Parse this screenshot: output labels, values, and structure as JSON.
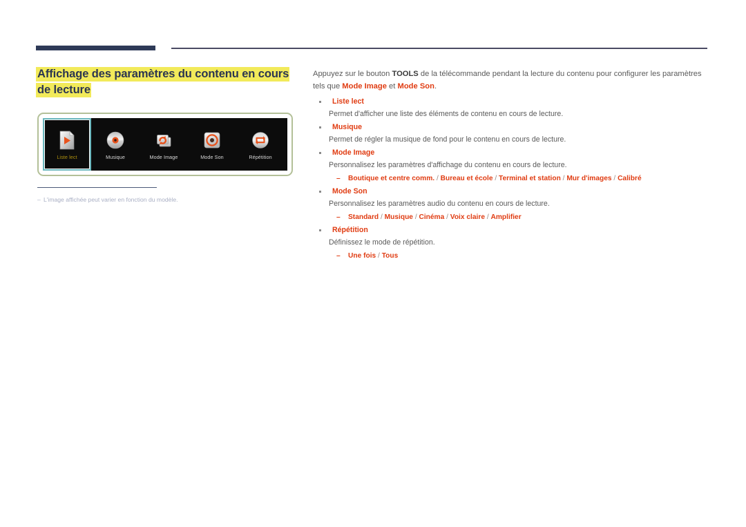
{
  "header": {
    "rule_thick": "navy-bar",
    "rule_thin": "thin-divider",
    "accent_navy": "#2e3a57",
    "accent_red": "#e03c12",
    "highlight_yellow": "#f2ea5a",
    "frame_green": "#b3c098"
  },
  "title": {
    "text": "Affichage des paramètres du contenu en cours de lecture"
  },
  "figure": {
    "tiles": [
      {
        "label": "Liste lect",
        "icon": "playlist-file-icon",
        "selected": true
      },
      {
        "label": "Musique",
        "icon": "music-disc-icon",
        "selected": false
      },
      {
        "label": "Mode Image",
        "icon": "picture-mode-refresh-icon",
        "selected": false
      },
      {
        "label": "Mode Son",
        "icon": "sound-mode-speaker-icon",
        "selected": false
      },
      {
        "label": "Répétition",
        "icon": "repeat-loop-icon",
        "selected": false
      }
    ],
    "caption_dash": "–",
    "caption": "L'image affichée peut varier en fonction du modèle."
  },
  "content": {
    "intro": {
      "part1": "Appuyez sur le bouton ",
      "bold1": "TOOLS",
      "part2": " de la télécommande pendant la lecture du contenu pour configurer les paramètres tels que ",
      "red1": "Mode Image",
      "part3": " et ",
      "red2": "Mode Son",
      "part4": "."
    },
    "items": [
      {
        "title": "Liste lect",
        "desc": "Permet d'afficher une liste des éléments de contenu en cours de lecture.",
        "options": []
      },
      {
        "title": "Musique",
        "desc": "Permet de régler la musique de fond pour le contenu en cours de lecture.",
        "options": []
      },
      {
        "title": "Mode Image",
        "desc": "Personnalisez les paramètres d'affichage du contenu en cours de lecture.",
        "options": [
          "Boutique et centre comm.",
          "Bureau et école",
          "Terminal et station",
          "Mur d'images",
          "Calibré"
        ]
      },
      {
        "title": "Mode Son",
        "desc": "Personnalisez les paramètres audio du contenu en cours de lecture.",
        "options": [
          "Standard",
          "Musique",
          "Cinéma",
          "Voix claire",
          "Amplifier"
        ]
      },
      {
        "title": "Répétition",
        "desc": "Définissez le mode de répétition.",
        "options": [
          "Une fois",
          "Tous"
        ]
      }
    ],
    "option_separator": " / ",
    "sub_dash": "–"
  }
}
